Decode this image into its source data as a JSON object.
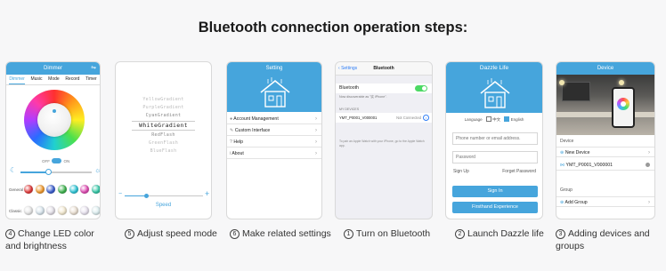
{
  "page_title": "Bluetooth connection operation steps:",
  "captions": [
    {
      "num": "4",
      "text": "Change LED color and brightness"
    },
    {
      "num": "5",
      "text": "Adjust speed mode"
    },
    {
      "num": "6",
      "text": "Make related settings"
    },
    {
      "num": "1",
      "text": "Turn on Bluetooth"
    },
    {
      "num": "2",
      "text": "Launch Dazzle life"
    },
    {
      "num": "3",
      "text": "Adding devices and groups"
    }
  ],
  "dimmer": {
    "title": "Dimmer",
    "tabs": [
      "Dimmer",
      "Music",
      "Mode",
      "Record",
      "Timer"
    ],
    "off_label": "OFF",
    "on_label": "ON",
    "general_label": "General",
    "classic_label": "Classic",
    "general_colors": [
      "#e23a3a",
      "#f29b2e",
      "#3b5fd0",
      "#3fb54f",
      "#2dc7d8",
      "#e14bb4",
      "#33c9a8"
    ],
    "classic_colors": [
      "#e8e8e8",
      "#d9e6ee",
      "#e3dfe7",
      "#f3e9cf",
      "#eadfd1",
      "#e9e3f0",
      "#dceef0"
    ]
  },
  "speed": {
    "modes": [
      "YellowGradient",
      "PurpleGradient",
      "CyanGradient",
      "WhiteGradient",
      "RedFlash",
      "GreenFlash",
      "BlueFlash"
    ],
    "label": "Speed",
    "slider_value": 0.28
  },
  "settings": {
    "title": "Setting",
    "items": [
      "Account Management",
      "Custom Interface",
      "Help",
      "About"
    ]
  },
  "bluetooth": {
    "back": "Settings",
    "title": "Bluetooth",
    "row_label": "Bluetooth",
    "discoverable": "Now discoverable as \"实 iPhone\".",
    "section": "MY DEVICES",
    "device": "YMT_P0001_V000001",
    "device_status": "Not Connected",
    "footnote": "To pair an Apple Watch with your iPhone, go to the Apple Watch app."
  },
  "dazzle": {
    "title": "Dazzle Life",
    "language_label": "Language",
    "lang_cn": "中文",
    "lang_en": "English",
    "phone_placeholder": "Phone number or email address.",
    "password_placeholder": "Password",
    "sign_up": "Sign Up",
    "forget": "Forget Password",
    "sign_in": "Sign In",
    "firsthand": "Firsthand Experience"
  },
  "devices": {
    "title": "Device",
    "device_header": "Device",
    "new_device": "New Device",
    "device_name": "YMT_P0001_V000001",
    "group_header": "Group",
    "add_group": "Add Group"
  }
}
